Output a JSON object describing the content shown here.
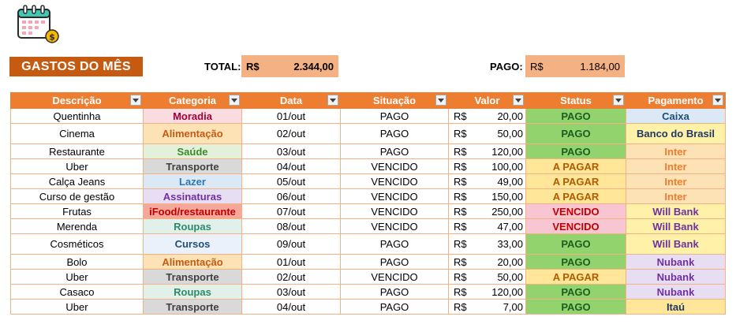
{
  "header": {
    "title": "GASTOS DO MÊS",
    "total_label": "TOTAL:",
    "total_currency": "R$",
    "total_value": "2.344,00",
    "pago_label": "PAGO:",
    "pago_currency": "R$",
    "pago_value": "1.184,00",
    "icon": "calendar-money-icon"
  },
  "table": {
    "columns": [
      "Descrição",
      "Categoria",
      "Data",
      "Situação",
      "Valor",
      "Status",
      "Pagamento"
    ],
    "rows": [
      {
        "descricao": "Quentinha",
        "categoria": "Moradia",
        "data": "01/out",
        "situacao": "PAGO",
        "moeda": "R$",
        "valor": "20,00",
        "status": "PAGO",
        "pagamento": "Caixa"
      },
      {
        "descricao": "Cinema",
        "categoria": "Alimentação",
        "data": "02/out",
        "situacao": "PAGO",
        "moeda": "R$",
        "valor": "50,00",
        "status": "PAGO",
        "pagamento": "Banco do Brasil"
      },
      {
        "descricao": "Restaurante",
        "categoria": "Saúde",
        "data": "03/out",
        "situacao": "PAGO",
        "moeda": "R$",
        "valor": "120,00",
        "status": "PAGO",
        "pagamento": "Inter"
      },
      {
        "descricao": "Uber",
        "categoria": "Transporte",
        "data": "04/out",
        "situacao": "VENCIDO",
        "moeda": "R$",
        "valor": "100,00",
        "status": "A PAGAR",
        "pagamento": "Inter"
      },
      {
        "descricao": "Calça Jeans",
        "categoria": "Lazer",
        "data": "05/out",
        "situacao": "VENCIDO",
        "moeda": "R$",
        "valor": "49,00",
        "status": "A PAGAR",
        "pagamento": "Inter"
      },
      {
        "descricao": "Curso de gestão",
        "categoria": "Assinaturas",
        "data": "06/out",
        "situacao": "VENCIDO",
        "moeda": "R$",
        "valor": "150,00",
        "status": "A PAGAR",
        "pagamento": "Inter"
      },
      {
        "descricao": "Frutas",
        "categoria": "iFood/restaurante",
        "data": "07/out",
        "situacao": "VENCIDO",
        "moeda": "R$",
        "valor": "250,00",
        "status": "VENCIDO",
        "pagamento": "Will Bank"
      },
      {
        "descricao": "Merenda",
        "categoria": "Roupas",
        "data": "08/out",
        "situacao": "VENCIDO",
        "moeda": "R$",
        "valor": "47,00",
        "status": "VENCIDO",
        "pagamento": "Will Bank"
      },
      {
        "descricao": "Cosméticos",
        "categoria": "Cursos",
        "data": "09/out",
        "situacao": "PAGO",
        "moeda": "R$",
        "valor": "33,00",
        "status": "PAGO",
        "pagamento": "Will Bank"
      },
      {
        "descricao": "Bolo",
        "categoria": "Alimentação",
        "data": "01/out",
        "situacao": "PAGO",
        "moeda": "R$",
        "valor": "20,00",
        "status": "PAGO",
        "pagamento": "Nubank"
      },
      {
        "descricao": "Uber",
        "categoria": "Transporte",
        "data": "02/out",
        "situacao": "VENCIDO",
        "moeda": "R$",
        "valor": "50,00",
        "status": "A PAGAR",
        "pagamento": "Nubank"
      },
      {
        "descricao": "Casaco",
        "categoria": "Roupas",
        "data": "03/out",
        "situacao": "PAGO",
        "moeda": "R$",
        "valor": "120,00",
        "status": "PAGO",
        "pagamento": "Nubank"
      },
      {
        "descricao": "Uber",
        "categoria": "Transporte",
        "data": "04/out",
        "situacao": "PAGO",
        "moeda": "R$",
        "valor": "7,00",
        "status": "PAGO",
        "pagamento": "Itaú"
      }
    ]
  },
  "colors": {
    "header_bg": "#ed7d31",
    "title_bg": "#c55a11",
    "sum_bg": "#f4b183",
    "categoria": {
      "Moradia": {
        "bg": "#fadbe0",
        "fg": "#a3003d"
      },
      "Alimentação": {
        "bg": "#fde2b5",
        "fg": "#c55a11"
      },
      "Saúde": {
        "bg": "#e3f1da",
        "fg": "#3a8a2c"
      },
      "Transporte": {
        "bg": "#d9d9d9",
        "fg": "#404040"
      },
      "Lazer": {
        "bg": "#dbe9f7",
        "fg": "#2e75b6"
      },
      "Assinaturas": {
        "bg": "#e8def4",
        "fg": "#7030a0"
      },
      "iFood/restaurante": {
        "bg": "#f4a79a",
        "fg": "#c00000"
      },
      "Roupas": {
        "bg": "#e2f0ea",
        "fg": "#2e8b6a"
      },
      "Cursos": {
        "bg": "#eaf1fb",
        "fg": "#1f4e79"
      }
    },
    "status": {
      "PAGO": {
        "bg": "#92d36e",
        "fg": "#1b5e20"
      },
      "A PAGAR": {
        "bg": "#ffe699",
        "fg": "#b35b00"
      },
      "VENCIDO": {
        "bg": "#f8c6d2",
        "fg": "#c00000"
      }
    },
    "pagamento": {
      "Caixa": {
        "bg": "#dbe9f7",
        "fg": "#1f4e79"
      },
      "Banco do Brasil": {
        "bg": "#fff2a8",
        "fg": "#1f3864"
      },
      "Inter": {
        "bg": "#fde2b5",
        "fg": "#ed7d31"
      },
      "Will Bank": {
        "bg": "#fff2a8",
        "fg": "#7030a0"
      },
      "Nubank": {
        "bg": "#e8def4",
        "fg": "#7030a0"
      },
      "Itaú": {
        "bg": "#ffe699",
        "fg": "#1f3864"
      }
    }
  }
}
